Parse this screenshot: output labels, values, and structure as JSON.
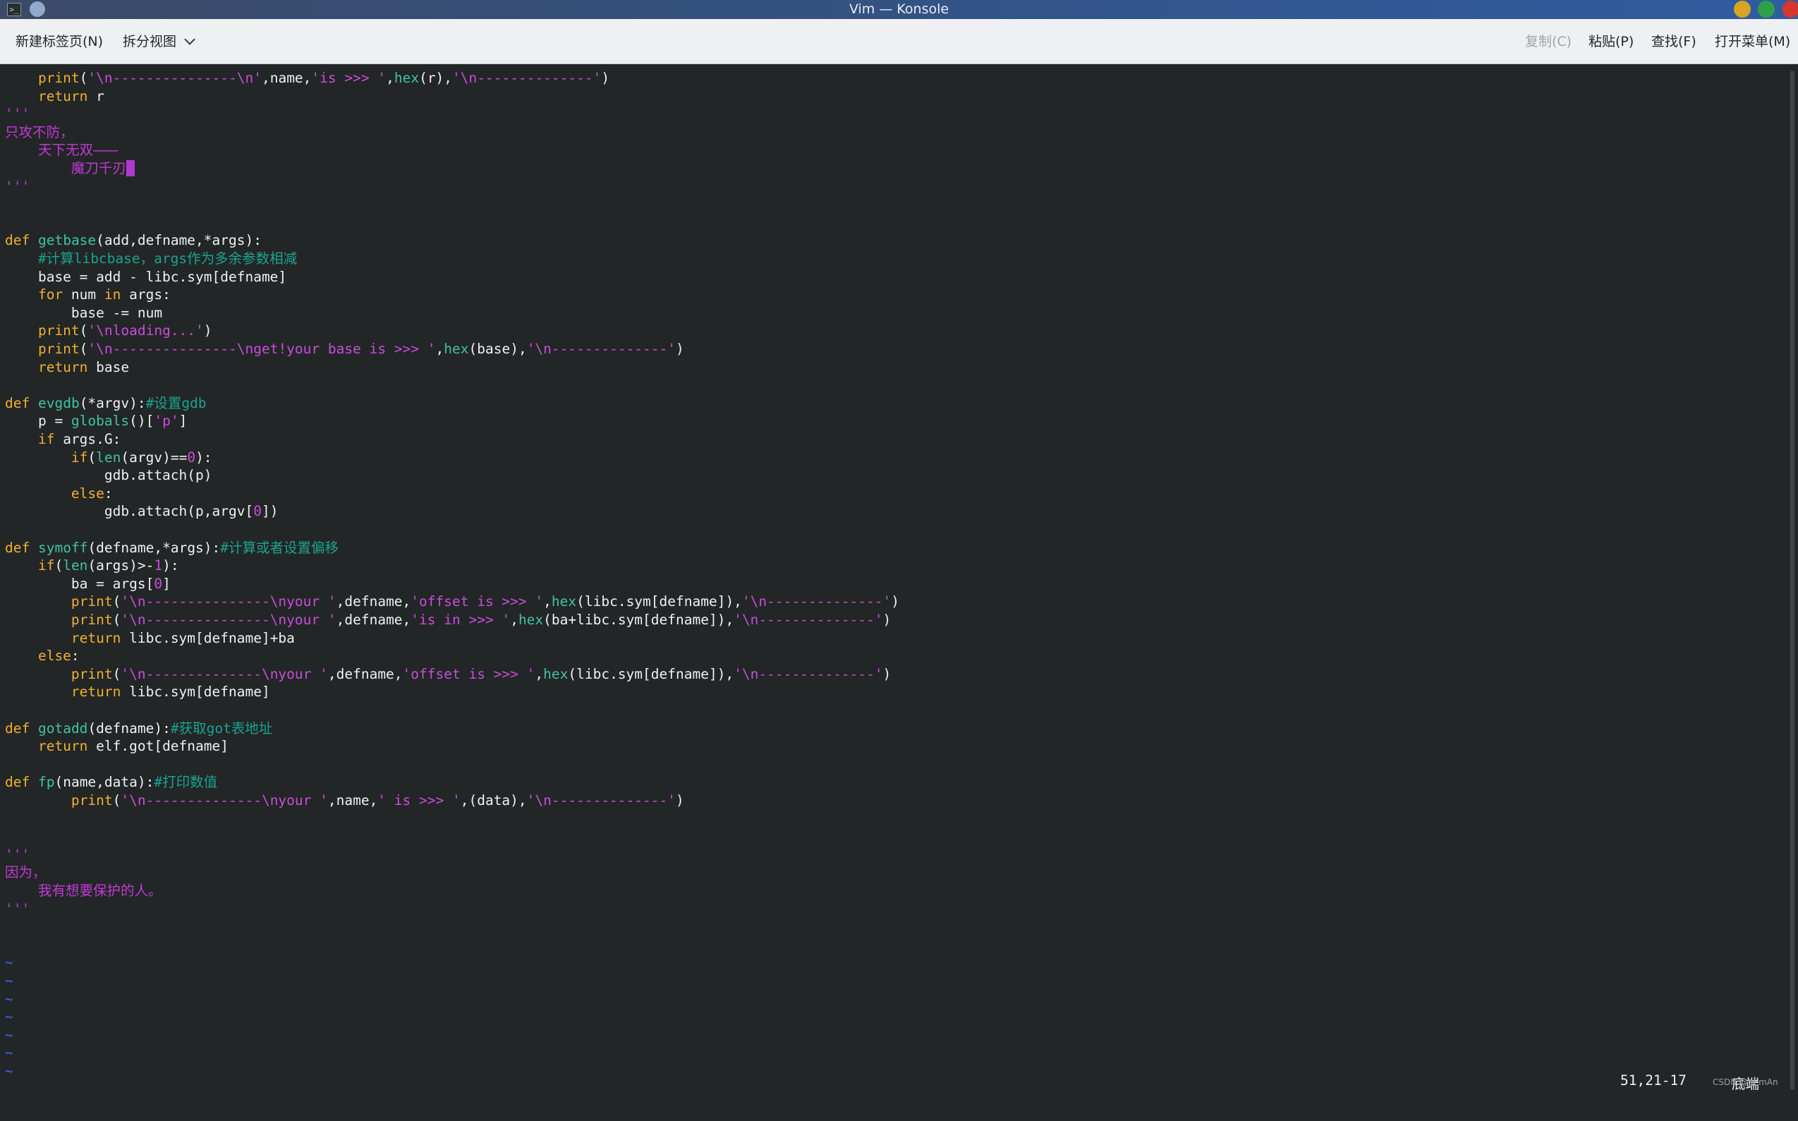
{
  "window": {
    "title": "Vim — Konsole",
    "icon_name": "terminal-icon",
    "colors": {
      "minimize": "#d8a424",
      "maximize": "#2fa04a",
      "close": "#d8362f"
    }
  },
  "toolbar": {
    "new_tab": "新建标签页(N)",
    "split_view": "拆分视图",
    "copy": "复制(C)",
    "paste": "粘贴(P)",
    "find": "查找(F)",
    "open_menu": "打开菜单(M)"
  },
  "editor": {
    "syntax_colors": {
      "keyword": "#f0b030",
      "function": "#3ec3a6",
      "string": "#c84ddb",
      "comment": "#1aa390",
      "docstring": "#bf3ad6",
      "tilde": "#3c56d8",
      "background": "#232627"
    },
    "lines": [
      [
        [
          "k",
          "    print"
        ],
        [
          "p",
          "("
        ],
        [
          "s",
          "'\\n---------------\\n'"
        ],
        [
          "p",
          ",name,"
        ],
        [
          "s",
          "'is >>> '"
        ],
        [
          "p",
          ","
        ],
        [
          "f",
          "hex"
        ],
        [
          "p",
          "(r),"
        ],
        [
          "s",
          "'\\n--------------'"
        ],
        [
          "p",
          ")"
        ]
      ],
      [
        [
          "k",
          "    return"
        ],
        [
          "p",
          " r"
        ]
      ],
      [
        [
          "d",
          "'''"
        ]
      ],
      [
        [
          "d",
          "只攻不防，"
        ]
      ],
      [
        [
          "d",
          "    天下无双———"
        ]
      ],
      [
        [
          "d",
          "        魔刀千刃"
        ],
        [
          "cur",
          " "
        ]
      ],
      [
        [
          "d",
          "'''"
        ]
      ],
      [],
      [],
      [
        [
          "k",
          "def"
        ],
        [
          "p",
          " "
        ],
        [
          "f",
          "getbase"
        ],
        [
          "p",
          "(add,defname,*args):"
        ]
      ],
      [
        [
          "p",
          "    "
        ],
        [
          "c",
          "#计算libcbase，args作为多余参数相减"
        ]
      ],
      [
        [
          "p",
          "    base = add - libc.sym[defname]"
        ]
      ],
      [
        [
          "k",
          "    for"
        ],
        [
          "p",
          " num "
        ],
        [
          "k",
          "in"
        ],
        [
          "p",
          " args:"
        ]
      ],
      [
        [
          "p",
          "        base -= num"
        ]
      ],
      [
        [
          "k",
          "    print"
        ],
        [
          "p",
          "("
        ],
        [
          "s",
          "'\\nloading...'"
        ],
        [
          "p",
          ")"
        ]
      ],
      [
        [
          "k",
          "    print"
        ],
        [
          "p",
          "("
        ],
        [
          "s",
          "'\\n---------------\\nget!your base is >>> '"
        ],
        [
          "p",
          ","
        ],
        [
          "f",
          "hex"
        ],
        [
          "p",
          "(base),"
        ],
        [
          "s",
          "'\\n--------------'"
        ],
        [
          "p",
          ")"
        ]
      ],
      [
        [
          "k",
          "    return"
        ],
        [
          "p",
          " base"
        ]
      ],
      [],
      [
        [
          "k",
          "def"
        ],
        [
          "p",
          " "
        ],
        [
          "f",
          "evgdb"
        ],
        [
          "p",
          "(*argv):"
        ],
        [
          "c",
          "#设置gdb"
        ]
      ],
      [
        [
          "p",
          "    p = "
        ],
        [
          "f",
          "globals"
        ],
        [
          "p",
          "()["
        ],
        [
          "s",
          "'p'"
        ],
        [
          "p",
          "]"
        ]
      ],
      [
        [
          "k",
          "    if"
        ],
        [
          "p",
          " args.G:"
        ]
      ],
      [
        [
          "k",
          "        if"
        ],
        [
          "p",
          "("
        ],
        [
          "f",
          "len"
        ],
        [
          "p",
          "(argv)=="
        ],
        [
          "n",
          "0"
        ],
        [
          "p",
          "):"
        ]
      ],
      [
        [
          "p",
          "            gdb.attach(p)"
        ]
      ],
      [
        [
          "k",
          "        else"
        ],
        [
          "p",
          ":"
        ]
      ],
      [
        [
          "p",
          "            gdb.attach(p,argv["
        ],
        [
          "n",
          "0"
        ],
        [
          "p",
          "])"
        ]
      ],
      [],
      [
        [
          "k",
          "def"
        ],
        [
          "p",
          " "
        ],
        [
          "f",
          "symoff"
        ],
        [
          "p",
          "(defname,*args):"
        ],
        [
          "c",
          "#计算或者设置偏移"
        ]
      ],
      [
        [
          "k",
          "    if"
        ],
        [
          "p",
          "("
        ],
        [
          "f",
          "len"
        ],
        [
          "p",
          "(args)>-"
        ],
        [
          "n",
          "1"
        ],
        [
          "p",
          "):"
        ]
      ],
      [
        [
          "p",
          "        ba = args["
        ],
        [
          "n",
          "0"
        ],
        [
          "p",
          "]"
        ]
      ],
      [
        [
          "k",
          "        print"
        ],
        [
          "p",
          "("
        ],
        [
          "s",
          "'\\n---------------\\nyour '"
        ],
        [
          "p",
          ",defname,"
        ],
        [
          "s",
          "'offset is >>> '"
        ],
        [
          "p",
          ","
        ],
        [
          "f",
          "hex"
        ],
        [
          "p",
          "(libc.sym[defname]),"
        ],
        [
          "s",
          "'\\n--------------'"
        ],
        [
          "p",
          ")"
        ]
      ],
      [
        [
          "k",
          "        print"
        ],
        [
          "p",
          "("
        ],
        [
          "s",
          "'\\n---------------\\nyour '"
        ],
        [
          "p",
          ",defname,"
        ],
        [
          "s",
          "'is in >>> '"
        ],
        [
          "p",
          ","
        ],
        [
          "f",
          "hex"
        ],
        [
          "p",
          "(ba+libc.sym[defname]),"
        ],
        [
          "s",
          "'\\n--------------'"
        ],
        [
          "p",
          ")"
        ]
      ],
      [
        [
          "k",
          "        return"
        ],
        [
          "p",
          " libc.sym[defname]+ba"
        ]
      ],
      [
        [
          "k",
          "    else"
        ],
        [
          "p",
          ":"
        ]
      ],
      [
        [
          "k",
          "        print"
        ],
        [
          "p",
          "("
        ],
        [
          "s",
          "'\\n--------------\\nyour '"
        ],
        [
          "p",
          ",defname,"
        ],
        [
          "s",
          "'offset is >>> '"
        ],
        [
          "p",
          ","
        ],
        [
          "f",
          "hex"
        ],
        [
          "p",
          "(libc.sym[defname]),"
        ],
        [
          "s",
          "'\\n--------------'"
        ],
        [
          "p",
          ")"
        ]
      ],
      [
        [
          "k",
          "        return"
        ],
        [
          "p",
          " libc.sym[defname]"
        ]
      ],
      [],
      [
        [
          "k",
          "def"
        ],
        [
          "p",
          " "
        ],
        [
          "f",
          "gotadd"
        ],
        [
          "p",
          "(defname):"
        ],
        [
          "c",
          "#获取got表地址"
        ]
      ],
      [
        [
          "k",
          "    return"
        ],
        [
          "p",
          " elf.got[defname]"
        ]
      ],
      [],
      [
        [
          "k",
          "def"
        ],
        [
          "p",
          " "
        ],
        [
          "f",
          "fp"
        ],
        [
          "p",
          "(name,data):"
        ],
        [
          "c",
          "#打印数值"
        ]
      ],
      [
        [
          "k",
          "        print"
        ],
        [
          "p",
          "("
        ],
        [
          "s",
          "'\\n--------------\\nyour '"
        ],
        [
          "p",
          ",name,"
        ],
        [
          "s",
          "' is >>> '"
        ],
        [
          "p",
          ",(data),"
        ],
        [
          "s",
          "'\\n--------------'"
        ],
        [
          "p",
          ")"
        ]
      ],
      [],
      [],
      [
        [
          "d",
          "'''"
        ]
      ],
      [
        [
          "d",
          "因为，"
        ]
      ],
      [
        [
          "d",
          "    我有想要保护的人。"
        ]
      ],
      [
        [
          "d",
          "'''"
        ]
      ],
      [],
      [],
      [
        [
          "t",
          "~"
        ]
      ],
      [
        [
          "t",
          "~"
        ]
      ],
      [
        [
          "t",
          "~"
        ]
      ],
      [
        [
          "t",
          "~"
        ]
      ],
      [
        [
          "t",
          "~"
        ]
      ],
      [
        [
          "t",
          "~"
        ]
      ],
      [
        [
          "t",
          "~"
        ]
      ]
    ],
    "status_position": "51,21-17",
    "status_percent": "底端",
    "watermark": "CSDN @gEmAn"
  }
}
